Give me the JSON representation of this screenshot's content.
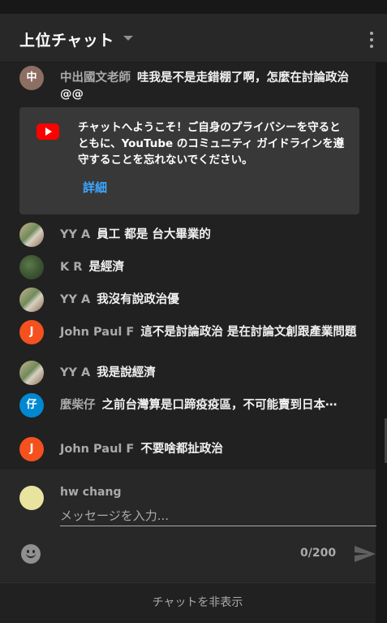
{
  "header": {
    "title": "上位チャット",
    "more_icon": "more-vert-icon",
    "dropdown_icon": "arrow-drop-down-icon"
  },
  "messages": [
    {
      "avatar_letter": "中",
      "avatar_color": "#8d6e63",
      "author": "中出國文老師",
      "text": "哇我是不是走錯棚了啊，怎麼在討論政治@@"
    },
    {
      "avatar_letter": "",
      "avatar_color": "",
      "author": "YY A",
      "text": "員工 都是 台大畢業的"
    },
    {
      "avatar_letter": "",
      "avatar_color": "",
      "author": "K R",
      "text": "是經濟"
    },
    {
      "avatar_letter": "",
      "avatar_color": "",
      "author": "YY A",
      "text": "我沒有說政治優"
    },
    {
      "avatar_letter": "J",
      "avatar_color": "#f4511e",
      "author": "John Paul F",
      "text": "這不是討論政治 是在討論文創跟產業問題"
    },
    {
      "avatar_letter": "",
      "avatar_color": "",
      "author": "YY A",
      "text": "我是說經濟"
    },
    {
      "avatar_letter": "仔",
      "avatar_color": "#0288d1",
      "author": "麼柴仔",
      "text": "之前台灣算是口蹄疫疫區，不可能賣到日本⋯"
    },
    {
      "avatar_letter": "J",
      "avatar_color": "#f4511e",
      "author": "John Paul F",
      "text": "不要啥都扯政治"
    }
  ],
  "welcome": {
    "text": "チャットへようこそ！ご自身のプライバシーを守るとともに、YouTube のコミュニティ ガイドラインを遵守することを忘れないでください。",
    "link": "詳細",
    "icon": "youtube-logo-icon"
  },
  "composer": {
    "user_name": "hw chang",
    "placeholder": "メッセージを入力...",
    "value": "",
    "counter": "0/200",
    "emoji_icon": "emoji-icon",
    "send_icon": "send-icon"
  },
  "footer": {
    "label": "チャットを非表示"
  },
  "colors": {
    "accent": "#3ea6ff",
    "youtube_red": "#ff0000",
    "panel_bg": "#212121",
    "header_bg": "#282828"
  }
}
